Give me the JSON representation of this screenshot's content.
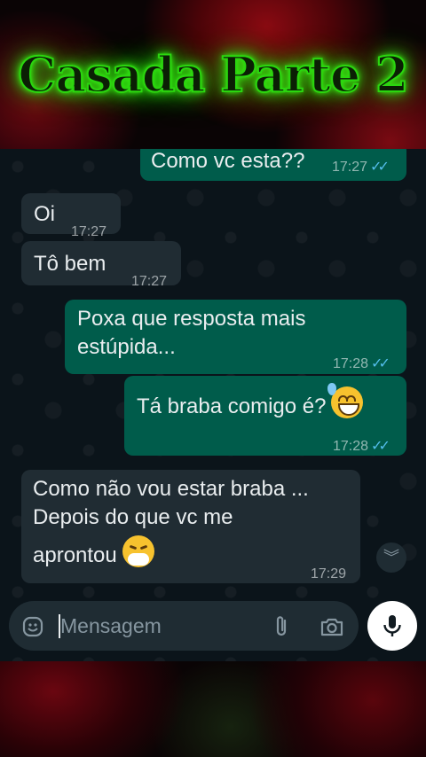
{
  "overlay": {
    "title": "Casada Parte 2"
  },
  "messages": [
    {
      "direction": "out",
      "text": "Como vc esta??",
      "time": "17:27",
      "status": "read"
    },
    {
      "direction": "in",
      "text": "Oi",
      "time": "17:27"
    },
    {
      "direction": "in",
      "text": "Tô bem",
      "time": "17:27"
    },
    {
      "direction": "out",
      "lines": [
        "Poxa que resposta mais",
        "estúpida..."
      ],
      "time": "17:28",
      "status": "read"
    },
    {
      "direction": "out",
      "text": "Tá braba comigo é?",
      "emoji": "grinning-face-with-sweat",
      "time": "17:28",
      "status": "read"
    },
    {
      "direction": "in",
      "lines": [
        "Como não vou estar braba ...",
        "Depois do que vc me",
        "aprontou"
      ],
      "emoji": "face-with-steam-from-nose",
      "time": "17:29"
    }
  ],
  "composer": {
    "placeholder": "Mensagem",
    "icons": [
      "sticker-icon",
      "attach-icon",
      "camera-icon",
      "mic-icon"
    ]
  },
  "scroll_down_icon": "chevron-double-down-icon",
  "colors": {
    "chat_bg": "#0b141a",
    "incoming": "#202c33",
    "outgoing": "#005c4b",
    "read_ticks": "#53bdeb",
    "title_glow": "#39ff14"
  }
}
